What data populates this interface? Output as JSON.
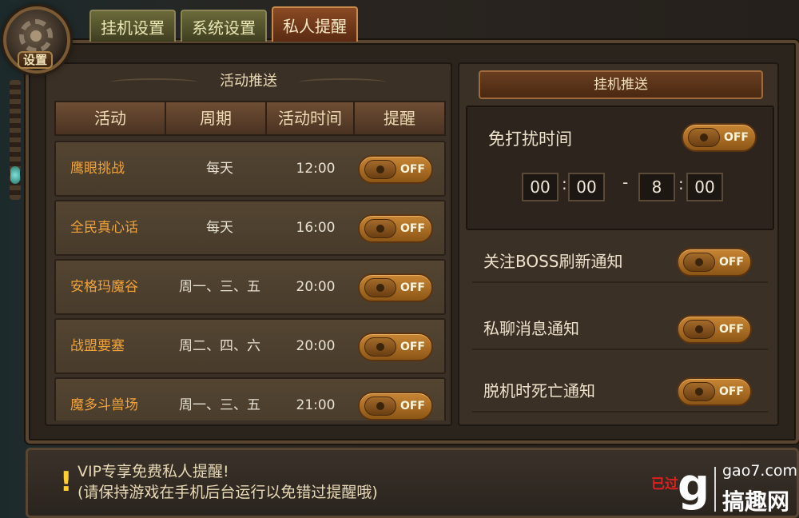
{
  "gear_label": "设置",
  "tabs": [
    {
      "label": "挂机设置",
      "active": false
    },
    {
      "label": "系统设置",
      "active": false
    },
    {
      "label": "私人提醒",
      "active": true
    }
  ],
  "left_panel": {
    "title": "活动推送",
    "columns": [
      "活动",
      "周期",
      "活动时间",
      "提醒"
    ],
    "rows": [
      {
        "activity": "鹰眼挑战",
        "period": "每天",
        "time": "12:00",
        "toggle": "OFF"
      },
      {
        "activity": "全民真心话",
        "period": "每天",
        "time": "16:00",
        "toggle": "OFF"
      },
      {
        "activity": "安格玛魔谷",
        "period": "周一、三、五",
        "time": "20:00",
        "toggle": "OFF"
      },
      {
        "activity": "战盟要塞",
        "period": "周二、四、六",
        "time": "20:00",
        "toggle": "OFF"
      },
      {
        "activity": "魔多斗兽场",
        "period": "周一、三、五",
        "time": "21:00",
        "toggle": "OFF"
      }
    ]
  },
  "right_panel": {
    "title": "挂机推送",
    "dnd": {
      "label": "免打扰时间",
      "toggle": "OFF",
      "start_hour": "00",
      "start_min": "00",
      "end_hour": "8",
      "end_min": "00",
      "sep": ":",
      "range_sep": "-"
    },
    "settings": [
      {
        "label": "关注BOSS刷新通知",
        "toggle": "OFF"
      },
      {
        "label": "私聊消息通知",
        "toggle": "OFF"
      },
      {
        "label": "脱机时死亡通知",
        "toggle": "OFF"
      }
    ]
  },
  "footer": {
    "exclaim": "!",
    "tip_line1": "VIP专享免费私人提醒!",
    "tip_line2": "(请保持游戏在手机后台运行以免错过提醒哦)",
    "expired": "已过"
  },
  "watermark": {
    "logo": "g",
    "site": "gao7.com",
    "name": "搞趣网"
  },
  "colors": {
    "accent_orange": "#f0a23a",
    "toggle_orange": "#c88634",
    "active_tab": "#8a4a24",
    "text_light": "#eee2cc",
    "expired_red": "#e02020"
  }
}
